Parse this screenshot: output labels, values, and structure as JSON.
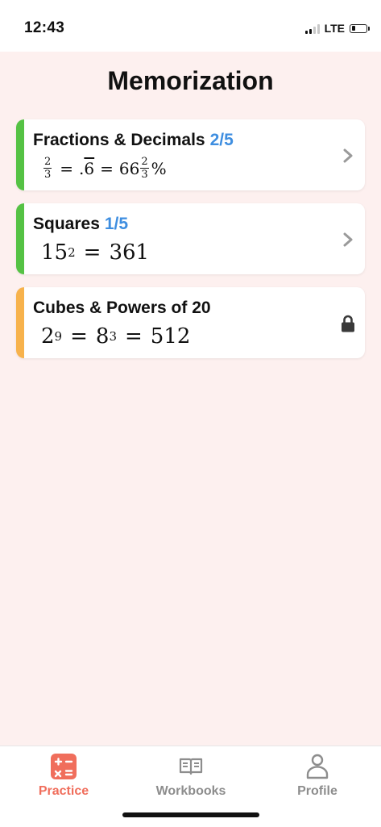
{
  "status": {
    "time": "12:43",
    "network": "LTE",
    "battery_level": 0.28
  },
  "page": {
    "title": "Memorization"
  },
  "colors": {
    "green": "#55c244",
    "orange": "#f7b24c",
    "progress_blue": "#3e8ee0",
    "active_tab": "#f06e5c",
    "inactive_tab": "#8d8d8d"
  },
  "cards": [
    {
      "title": "Fractions & Decimals",
      "progress": "2/5",
      "formula": {
        "frac1_num": "2",
        "frac1_den": "3",
        "eq1": "=",
        "dec_prefix": ".",
        "dec_repeat": "6",
        "eq2": "=",
        "whole": "66",
        "frac2_num": "2",
        "frac2_den": "3",
        "percent": "%"
      },
      "accent": "green",
      "state": "unlocked",
      "icon": "chevron-right-icon"
    },
    {
      "title": "Squares",
      "progress": "1/5",
      "formula": {
        "base": "15",
        "exp": "2",
        "eq": "=",
        "result": "361"
      },
      "accent": "green",
      "state": "unlocked",
      "icon": "chevron-right-icon"
    },
    {
      "title": "Cubes & Powers of 20",
      "formula": {
        "base1": "2",
        "exp1": "9",
        "eq1": "=",
        "base2": "8",
        "exp2": "3",
        "eq2": "=",
        "result": "512"
      },
      "accent": "orange",
      "state": "locked",
      "icon": "lock-icon"
    }
  ],
  "tabs": [
    {
      "label": "Practice",
      "icon": "calculator-icon",
      "active": true
    },
    {
      "label": "Workbooks",
      "icon": "book-icon",
      "active": false
    },
    {
      "label": "Profile",
      "icon": "person-icon",
      "active": false
    }
  ]
}
